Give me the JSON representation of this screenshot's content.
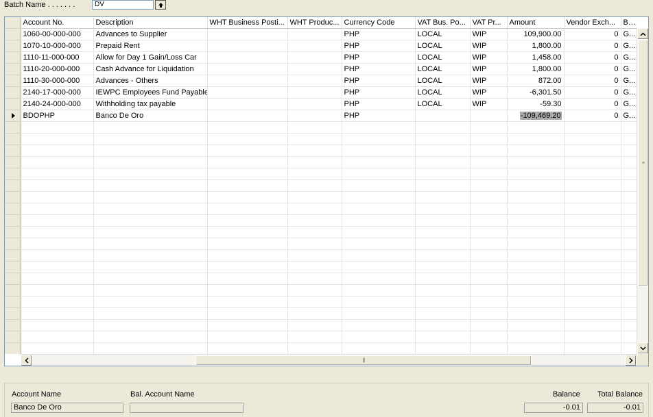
{
  "batch": {
    "label": "Batch Name . . . . . . .",
    "value": "DV"
  },
  "columns": [
    "Account No.",
    "Description",
    "WHT Business Posti...",
    "WHT Produc...",
    "Currency Code",
    "VAT Bus. Po...",
    "VAT Pr...",
    "Amount",
    "Vendor Exch...",
    "B..."
  ],
  "rows": [
    [
      "1060-00-000-000",
      "Advances to Supplier",
      "",
      "",
      "PHP",
      "LOCAL",
      "WIP",
      "109,900.00",
      "0",
      "G..."
    ],
    [
      "1070-10-000-000",
      "Prepaid Rent",
      "",
      "",
      "PHP",
      "LOCAL",
      "WIP",
      "1,800.00",
      "0",
      "G..."
    ],
    [
      "1110-11-000-000",
      "Allow for Day 1 Gain/Loss Car",
      "",
      "",
      "PHP",
      "LOCAL",
      "WIP",
      "1,458.00",
      "0",
      "G..."
    ],
    [
      "1110-20-000-000",
      "Cash Advance for Liquidation",
      "",
      "",
      "PHP",
      "LOCAL",
      "WIP",
      "1,800.00",
      "0",
      "G..."
    ],
    [
      "1110-30-000-000",
      "Advances - Others",
      "",
      "",
      "PHP",
      "LOCAL",
      "WIP",
      "872.00",
      "0",
      "G..."
    ],
    [
      "2140-17-000-000",
      "IEWPC Employees Fund Payable",
      "",
      "",
      "PHP",
      "LOCAL",
      "WIP",
      "-6,301.50",
      "0",
      "G..."
    ],
    [
      "2140-24-000-000",
      "Withholding tax payable",
      "",
      "",
      "PHP",
      "LOCAL",
      "WIP",
      "-59.30",
      "0",
      "G..."
    ],
    [
      "BDOPHP",
      "Banco De Oro",
      "",
      "",
      "PHP",
      "",
      "",
      "-109,469.20",
      "0",
      "G..."
    ]
  ],
  "footer": {
    "account_name_label": "Account Name",
    "account_name_value": "Banco De Oro",
    "bal_account_name_label": "Bal. Account Name",
    "bal_account_name_value": "",
    "balance_label": "Balance",
    "balance_value": "-0.01",
    "total_balance_label": "Total Balance",
    "total_balance_value": "-0.01"
  }
}
